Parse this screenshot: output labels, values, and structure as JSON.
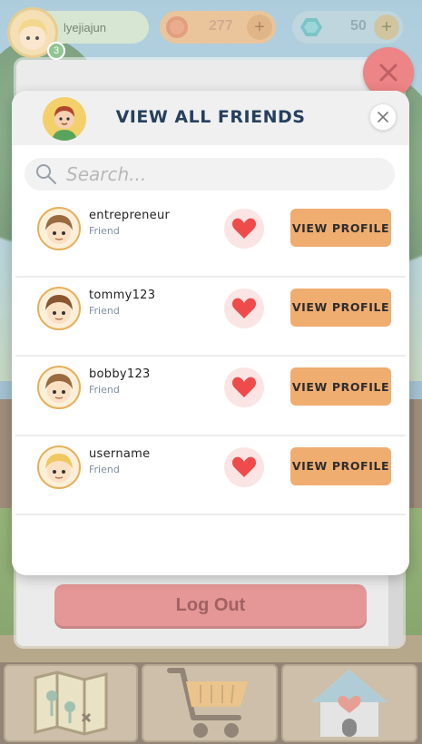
{
  "hud": {
    "username": "lyejiajun",
    "level": "3",
    "coins": "277",
    "gems": "50",
    "plus_label": "+"
  },
  "background_panel": {
    "logout_label": "Log Out",
    "close_label": "✕"
  },
  "modal": {
    "title": "VIEW ALL FRIENDS",
    "close_label": "✕",
    "search_placeholder": "Search...",
    "friends": [
      {
        "name": "entrepreneur",
        "status": "Friend",
        "action_label": "VIEW PROFILE",
        "hair": "#9a6b3e"
      },
      {
        "name": "tommy123",
        "status": "Friend",
        "action_label": "VIEW PROFILE",
        "hair": "#8a5630"
      },
      {
        "name": "bobby123",
        "status": "Friend",
        "action_label": "VIEW PROFILE",
        "hair": "#9a6b3e"
      },
      {
        "name": "username",
        "status": "Friend",
        "action_label": "VIEW PROFILE",
        "hair": "#f0c860"
      }
    ]
  },
  "bottom_nav": [
    {
      "icon": "map-icon"
    },
    {
      "icon": "shopping-cart-icon"
    },
    {
      "icon": "home-heart-icon"
    }
  ],
  "colors": {
    "accent_orange": "#f0ad70",
    "heart_red": "#ef4b4b",
    "title_navy": "#26405e",
    "logout_red": "#e07f7f"
  }
}
